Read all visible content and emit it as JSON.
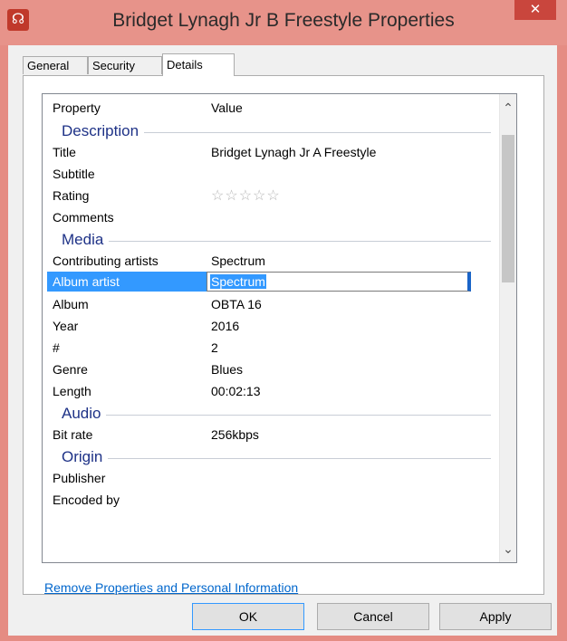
{
  "window": {
    "title": "Bridget Lynagh Jr B Freestyle Properties",
    "app_icon": "headphones-icon",
    "close_glyph": "✕"
  },
  "tabs": [
    "General",
    "Security",
    "Details"
  ],
  "active_tab": "Details",
  "list": {
    "header": {
      "property": "Property",
      "value": "Value"
    },
    "groups": [
      {
        "name": "Description",
        "rows": [
          {
            "property": "Title",
            "value": "Bridget Lynagh Jr A Freestyle"
          },
          {
            "property": "Subtitle",
            "value": ""
          },
          {
            "property": "Rating",
            "value": "",
            "stars": 0,
            "max_stars": 5
          },
          {
            "property": "Comments",
            "value": ""
          }
        ]
      },
      {
        "name": "Media",
        "rows": [
          {
            "property": "Contributing artists",
            "value": "Spectrum"
          },
          {
            "property": "Album artist",
            "value": "Spectrum",
            "selected": true
          },
          {
            "property": "Album",
            "value": "OBTA 16"
          },
          {
            "property": "Year",
            "value": "2016"
          },
          {
            "property": "#",
            "value": "2"
          },
          {
            "property": "Genre",
            "value": "Blues"
          },
          {
            "property": "Length",
            "value": "00:02:13"
          }
        ]
      },
      {
        "name": "Audio",
        "rows": [
          {
            "property": "Bit rate",
            "value": "256kbps"
          }
        ]
      },
      {
        "name": "Origin",
        "rows": [
          {
            "property": "Publisher",
            "value": ""
          },
          {
            "property": "Encoded by",
            "value": ""
          }
        ]
      }
    ]
  },
  "remove_link": "Remove Properties and Personal Information",
  "buttons": {
    "ok": "OK",
    "cancel": "Cancel",
    "apply": "Apply"
  },
  "scroll": {
    "up_glyph": "⌃",
    "down_glyph": "⌄"
  },
  "colors": {
    "titlebar": "#e7938a",
    "selection": "#3399ff",
    "group_heading": "#1e3287",
    "link": "#0066cc"
  }
}
